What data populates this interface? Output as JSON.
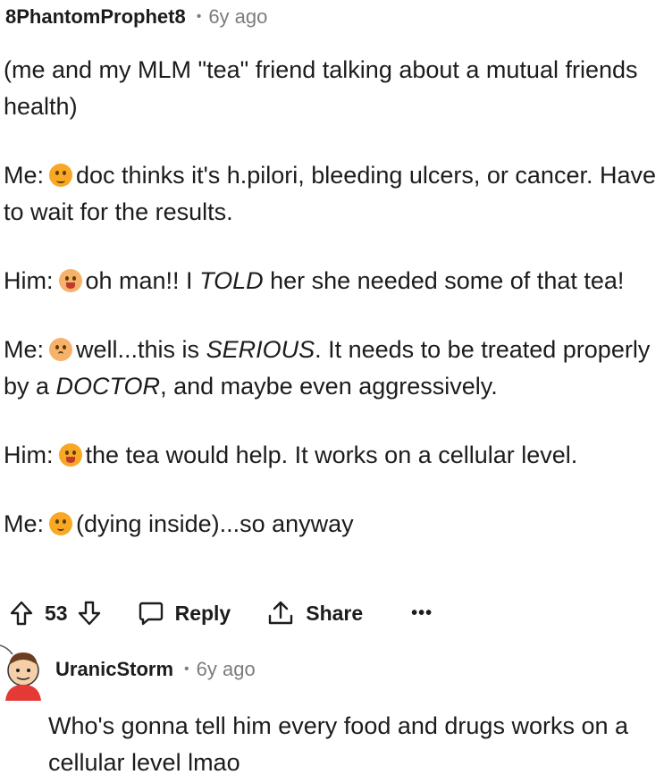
{
  "comment": {
    "username": "8PhantomProphet8",
    "separator": "•",
    "time": "6y ago",
    "intro": "(me and my MLM \"tea\" friend talking about a mutual friends health)",
    "lines": [
      {
        "speaker": "Me:",
        "text": "doc thinks it's h.pilori, bleeding ulcers, or cancer. Have to wait for the results."
      },
      {
        "speaker": "Him:",
        "text_a": "oh man!! I ",
        "text_em": "TOLD",
        "text_b": " her she needed some of that tea!"
      },
      {
        "speaker": "Me:",
        "text_a": "well...this is ",
        "text_em": "SERIOUS",
        "text_b": ". It needs to be treated properly by a ",
        "text_em2": "DOCTOR",
        "text_c": ", and maybe even aggressively."
      },
      {
        "speaker": "Him:",
        "text": "the tea would help. It works on a cellular level."
      },
      {
        "speaker": "Me:",
        "text": "(dying inside)...so anyway"
      }
    ],
    "emojis": [
      "sad-face-emoji",
      "surprised-face-emoji",
      "flushed-face-emoji",
      "grinning-face-emoji",
      "pensive-face-emoji"
    ]
  },
  "actions": {
    "vote_count": "53",
    "reply_label": "Reply",
    "share_label": "Share",
    "more_label": "•••"
  },
  "reply": {
    "username": "UranicStorm",
    "separator": "•",
    "time": "6y ago",
    "text": "Who's gonna tell him every food and drugs works on a cellular level lmao"
  }
}
